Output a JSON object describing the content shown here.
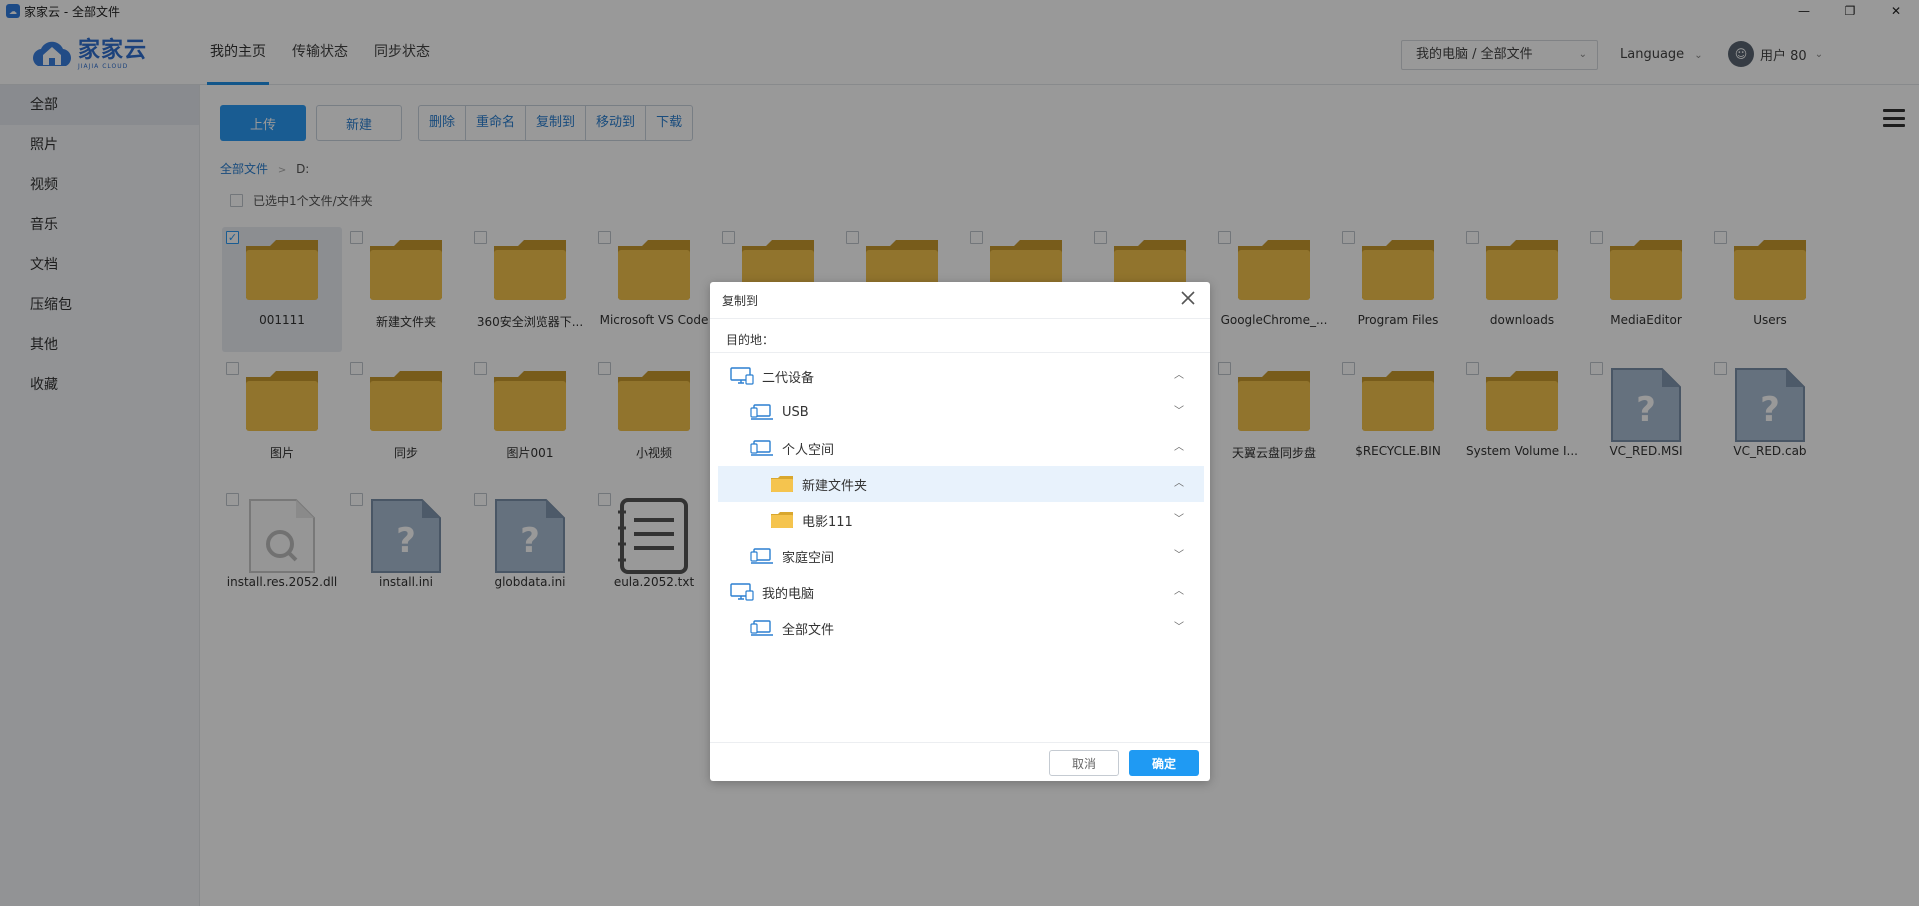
{
  "window": {
    "title": "家家云 - 全部文件",
    "min": "—",
    "restore": "❐",
    "close": "✕"
  },
  "logo": {
    "name": "家家云",
    "sub": "JIAJIA CLOUD"
  },
  "topnav": [
    {
      "label": "我的主页"
    },
    {
      "label": "传输状态"
    },
    {
      "label": "同步状态"
    }
  ],
  "header": {
    "path_select": "我的电脑 / 全部文件",
    "language": "Language",
    "user": "用户 80"
  },
  "sidebar": {
    "items": [
      {
        "label": "全部"
      },
      {
        "label": "照片"
      },
      {
        "label": "视频"
      },
      {
        "label": "音乐"
      },
      {
        "label": "文档"
      },
      {
        "label": "压缩包"
      },
      {
        "label": "其他"
      },
      {
        "label": "收藏"
      }
    ]
  },
  "toolbar": {
    "upload": "上传",
    "new": "新建",
    "delete": "删除",
    "rename": "重命名",
    "copy_to": "复制到",
    "move_to": "移动到",
    "download": "下载"
  },
  "breadcrumb": {
    "root": "全部文件",
    "sep": ">",
    "current": "D:"
  },
  "selection_text": "已选中1个文件/文件夹",
  "files": [
    [
      {
        "name": "001111",
        "type": "folder",
        "selected": true
      },
      {
        "name": "新建文件夹",
        "type": "folder"
      },
      {
        "name": "360安全浏览器下...",
        "type": "folder"
      },
      {
        "name": "Microsoft VS Code",
        "type": "folder"
      },
      {
        "name": "",
        "type": "folder"
      },
      {
        "name": "",
        "type": "folder"
      },
      {
        "name": "",
        "type": "folder"
      },
      {
        "name": "",
        "type": "folder"
      },
      {
        "name": "GoogleChrome_...",
        "type": "folder"
      },
      {
        "name": "Program Files",
        "type": "folder"
      },
      {
        "name": "downloads",
        "type": "folder"
      },
      {
        "name": "MediaEditor",
        "type": "folder"
      },
      {
        "name": "Users",
        "type": "folder"
      }
    ],
    [
      {
        "name": "图片",
        "type": "folder"
      },
      {
        "name": "同步",
        "type": "folder"
      },
      {
        "name": "图片001",
        "type": "folder"
      },
      {
        "name": "小视频",
        "type": "folder"
      },
      {
        "name": "",
        "type": "folder"
      },
      {
        "name": "",
        "type": "folder"
      },
      {
        "name": "",
        "type": "folder"
      },
      {
        "name": "",
        "type": "folder"
      },
      {
        "name": "天翼云盘同步盘",
        "type": "folder"
      },
      {
        "name": "$RECYCLE.BIN",
        "type": "folder"
      },
      {
        "name": "System Volume I...",
        "type": "folder"
      },
      {
        "name": "VC_RED.MSI",
        "type": "unknown"
      },
      {
        "name": "VC_RED.cab",
        "type": "unknown"
      }
    ],
    [
      {
        "name": "install.res.2052.dll",
        "type": "dll"
      },
      {
        "name": "install.ini",
        "type": "unknown"
      },
      {
        "name": "globdata.ini",
        "type": "unknown"
      },
      {
        "name": "eula.2052.txt",
        "type": "txt"
      }
    ]
  ],
  "dialog": {
    "title": "复制到",
    "destination_label": "目的地：",
    "tree": [
      {
        "label": "二代设备",
        "icon": "monitor-icon",
        "level": 0,
        "expanded": true
      },
      {
        "label": "USB",
        "icon": "laptop-icon",
        "level": 1,
        "expanded": false
      },
      {
        "label": "个人空间",
        "icon": "laptop-icon",
        "level": 1,
        "expanded": true
      },
      {
        "label": "新建文件夹",
        "icon": "folder-icon",
        "level": 2,
        "expanded": true,
        "highlighted": true
      },
      {
        "label": "电影111",
        "icon": "folder-icon",
        "level": 2,
        "expanded": false
      },
      {
        "label": "家庭空间",
        "icon": "laptop-icon",
        "level": 1,
        "expanded": false
      },
      {
        "label": "我的电脑",
        "icon": "monitor-icon",
        "level": 0,
        "expanded": true
      },
      {
        "label": "全部文件",
        "icon": "laptop-icon",
        "level": 1,
        "expanded": false
      }
    ],
    "cancel": "取消",
    "ok": "确定"
  },
  "colors": {
    "accent": "#2b9af3",
    "folder": "#f5c44e",
    "overlay": "rgba(0,0,0,0.4)"
  }
}
